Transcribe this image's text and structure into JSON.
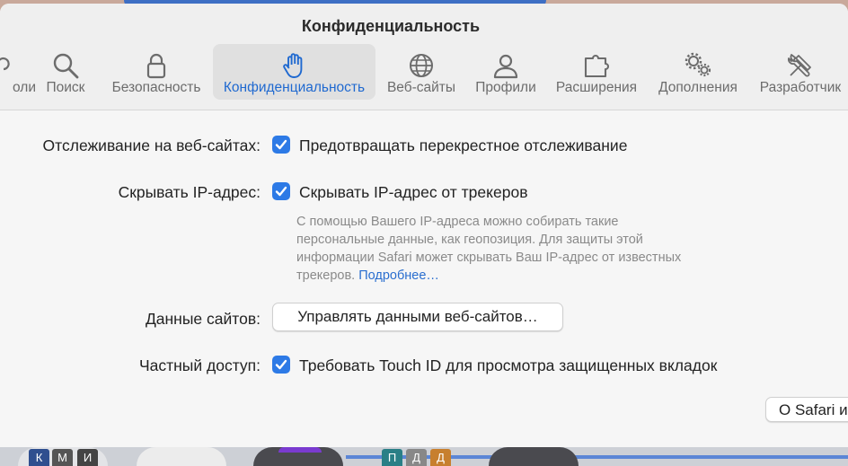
{
  "window": {
    "title": "Конфиденциальность"
  },
  "toolbar": {
    "tabs": [
      {
        "label": "оли",
        "icon": "partial-icon"
      },
      {
        "label": "Поиск",
        "icon": "search-icon"
      },
      {
        "label": "Безопасность",
        "icon": "lock-icon"
      },
      {
        "label": "Конфиденциальность",
        "icon": "hand-icon"
      },
      {
        "label": "Веб-сайты",
        "icon": "globe-icon"
      },
      {
        "label": "Профили",
        "icon": "person-icon"
      },
      {
        "label": "Расширения",
        "icon": "puzzle-icon"
      },
      {
        "label": "Дополнения",
        "icon": "gears-icon"
      },
      {
        "label": "Разработчик",
        "icon": "tools-icon"
      }
    ],
    "active_tab": "Конфиденциальность"
  },
  "settings": {
    "tracking": {
      "label": "Отслеживание на веб-сайтах:",
      "checkbox": "Предотвращать перекрестное отслеживание",
      "checked": true
    },
    "ip": {
      "label": "Скрывать IP-адрес:",
      "checkbox": "Скрывать IP-адрес от трекеров",
      "checked": true,
      "desc_line1": "С помощью Вашего IP-адреса можно собирать такие",
      "desc_line2": "персональные данные, как геопозиция. Для защиты этой",
      "desc_line3": "информации Safari может скрывать Ваш IP-адрес от известных",
      "desc_line4": "трекеров.",
      "link": "Подробнее…"
    },
    "website_data": {
      "label": "Данные сайтов:",
      "button": "Управлять данными веб-сайтов…"
    },
    "private": {
      "label": "Частный доступ:",
      "checkbox": "Требовать Touch ID для просмотра защищенных вкладок",
      "checked": true
    }
  },
  "footer": {
    "about_button": "О Safari и"
  },
  "dock": {
    "keys_left": [
      "К",
      "М",
      "И"
    ],
    "keys_right": [
      "П",
      "Д",
      "Д"
    ]
  },
  "colors": {
    "accent": "#2d7ae6",
    "link": "#2a6ecf",
    "active_tab_text": "#1f69d0"
  }
}
